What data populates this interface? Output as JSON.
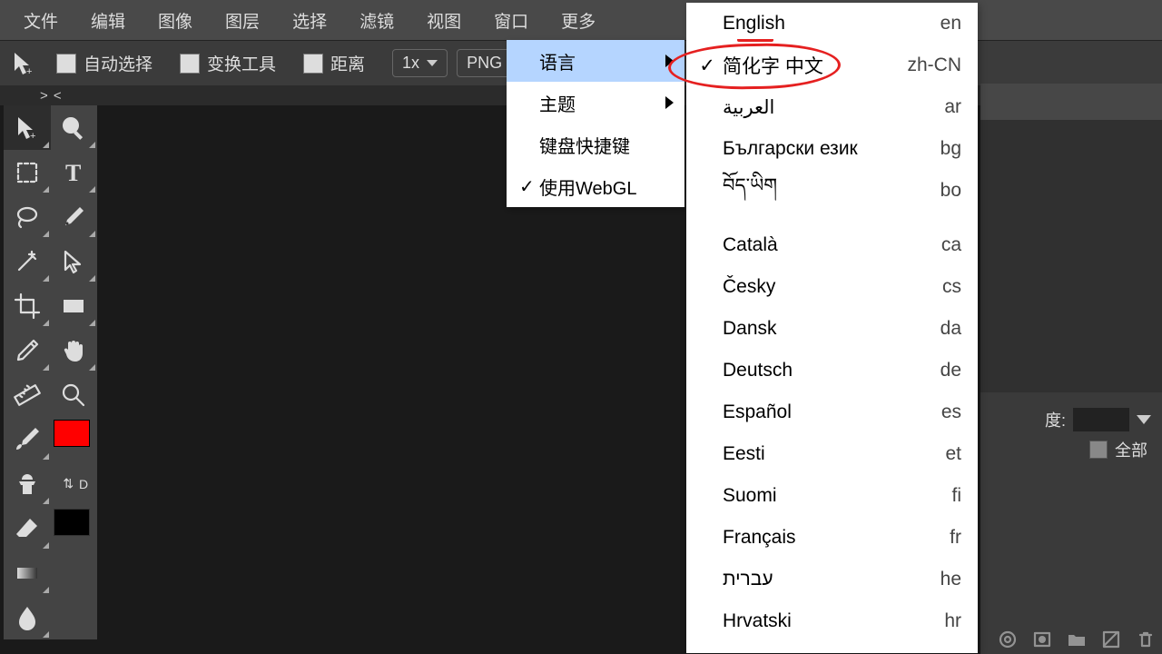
{
  "menubar": {
    "file": "文件",
    "edit": "编辑",
    "image": "图像",
    "layer": "图层",
    "select": "选择",
    "filter": "滤镜",
    "view": "视图",
    "window": "窗口",
    "more": "更多"
  },
  "options": {
    "auto_select": "自动选择",
    "transform_tool": "变换工具",
    "distance": "距离",
    "scale_label": "1x",
    "png_label": "PNG"
  },
  "strip_label": "> <",
  "swatch": {
    "swap_text": "⇅",
    "default_text": "D"
  },
  "submenu_more": {
    "language": "语言",
    "theme": "主题",
    "shortcuts": "键盘快捷键",
    "use_webgl": "使用WebGL",
    "check": "✓"
  },
  "languages": [
    {
      "name": "English",
      "code": "en",
      "selected": false
    },
    {
      "name": "简化字 中文",
      "code": "zh-CN",
      "selected": true
    },
    {
      "name": "العربية",
      "code": "ar",
      "selected": false
    },
    {
      "name": "Български език",
      "code": "bg",
      "selected": false
    },
    {
      "name": "བོད་ཡིག",
      "code": "bo",
      "selected": false
    },
    {
      "name": "Català",
      "code": "ca",
      "selected": false
    },
    {
      "name": "Česky",
      "code": "cs",
      "selected": false
    },
    {
      "name": "Dansk",
      "code": "da",
      "selected": false
    },
    {
      "name": "Deutsch",
      "code": "de",
      "selected": false
    },
    {
      "name": "Español",
      "code": "es",
      "selected": false
    },
    {
      "name": "Eesti",
      "code": "et",
      "selected": false
    },
    {
      "name": "Suomi",
      "code": "fi",
      "selected": false
    },
    {
      "name": "Français",
      "code": "fr",
      "selected": false
    },
    {
      "name": "עברית",
      "code": "he",
      "selected": false
    },
    {
      "name": "Hrvatski",
      "code": "hr",
      "selected": false
    }
  ],
  "lang_check": "✓",
  "right_panel": {
    "opacity_label": "度:",
    "all_label": "全部"
  }
}
